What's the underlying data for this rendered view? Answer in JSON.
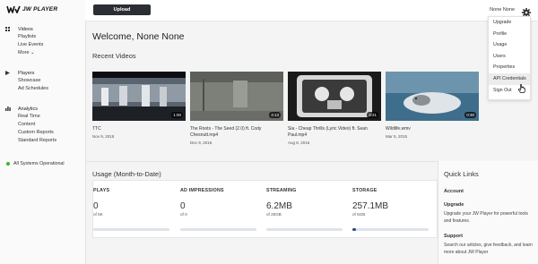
{
  "brand": {
    "name": "JW PLAYER"
  },
  "sidebar": {
    "sections": [
      {
        "label": "Videos",
        "icon": "grid-icon",
        "items": [
          "Playlists",
          "Live Events",
          "More ⌄"
        ]
      },
      {
        "label": "Players",
        "icon": "play-icon",
        "items": [
          "Showcase",
          "Ad Schedules"
        ]
      },
      {
        "label": "Analytics",
        "icon": "bar-chart-icon",
        "items": [
          "Real Time",
          "Content",
          "Custom Reports",
          "Standard Reports"
        ]
      }
    ],
    "status": "All Systems Operational"
  },
  "topbar": {
    "upload_label": "Upload",
    "user_name": "None None"
  },
  "dropdown": {
    "items": [
      "Upgrade",
      "Profile",
      "Usage",
      "Users",
      "Properties",
      "API Credentials",
      "Sign Out"
    ],
    "hovered": "API Credentials"
  },
  "welcome": "Welcome, None None",
  "recent_videos": {
    "title": "Recent Videos",
    "videos": [
      {
        "title": "TTC",
        "date": "Nov 9, 2018",
        "duration": "1:00"
      },
      {
        "title": "The Roots - The Seed (2.0) ft. Cody Chesnutt.mp4",
        "date": "Dec 9, 2016",
        "duration": "4:13"
      },
      {
        "title": "Sia - Cheap Thrills (Lyric Video) ft. Sean Paul.mp4",
        "date": "Aug 8, 2016",
        "duration": "4:21"
      },
      {
        "title": "Wildlife.wmv",
        "date": "Mar 5, 2015",
        "duration": "0:30"
      }
    ]
  },
  "usage": {
    "title": "Usage (Month-to-Date)",
    "stats": [
      {
        "label": "PLAYS",
        "value": "0",
        "sub": "of 5K",
        "fraction": 0
      },
      {
        "label": "AD IMPRESSIONS",
        "value": "0",
        "sub": "of 0",
        "fraction": 0
      },
      {
        "label": "STREAMING",
        "value": "6.2MB",
        "sub": "of 25GB",
        "fraction": 0
      },
      {
        "label": "STORAGE",
        "value": "257.1MB",
        "sub": "of 5GB",
        "fraction": 0.05
      }
    ]
  },
  "quick_links": {
    "title": "Quick Links",
    "account": "Account",
    "upgrade_head": "Upgrade",
    "upgrade_text": "Upgrade your JW Player for powerful tools and features.",
    "support_head": "Support",
    "support_text": "Search our articles, give feedback, and learn more about JW Player"
  },
  "colors": {
    "accent": "#2c4a7a",
    "status_ok": "#2eb82e",
    "topbar_button": "#2b2f33"
  }
}
